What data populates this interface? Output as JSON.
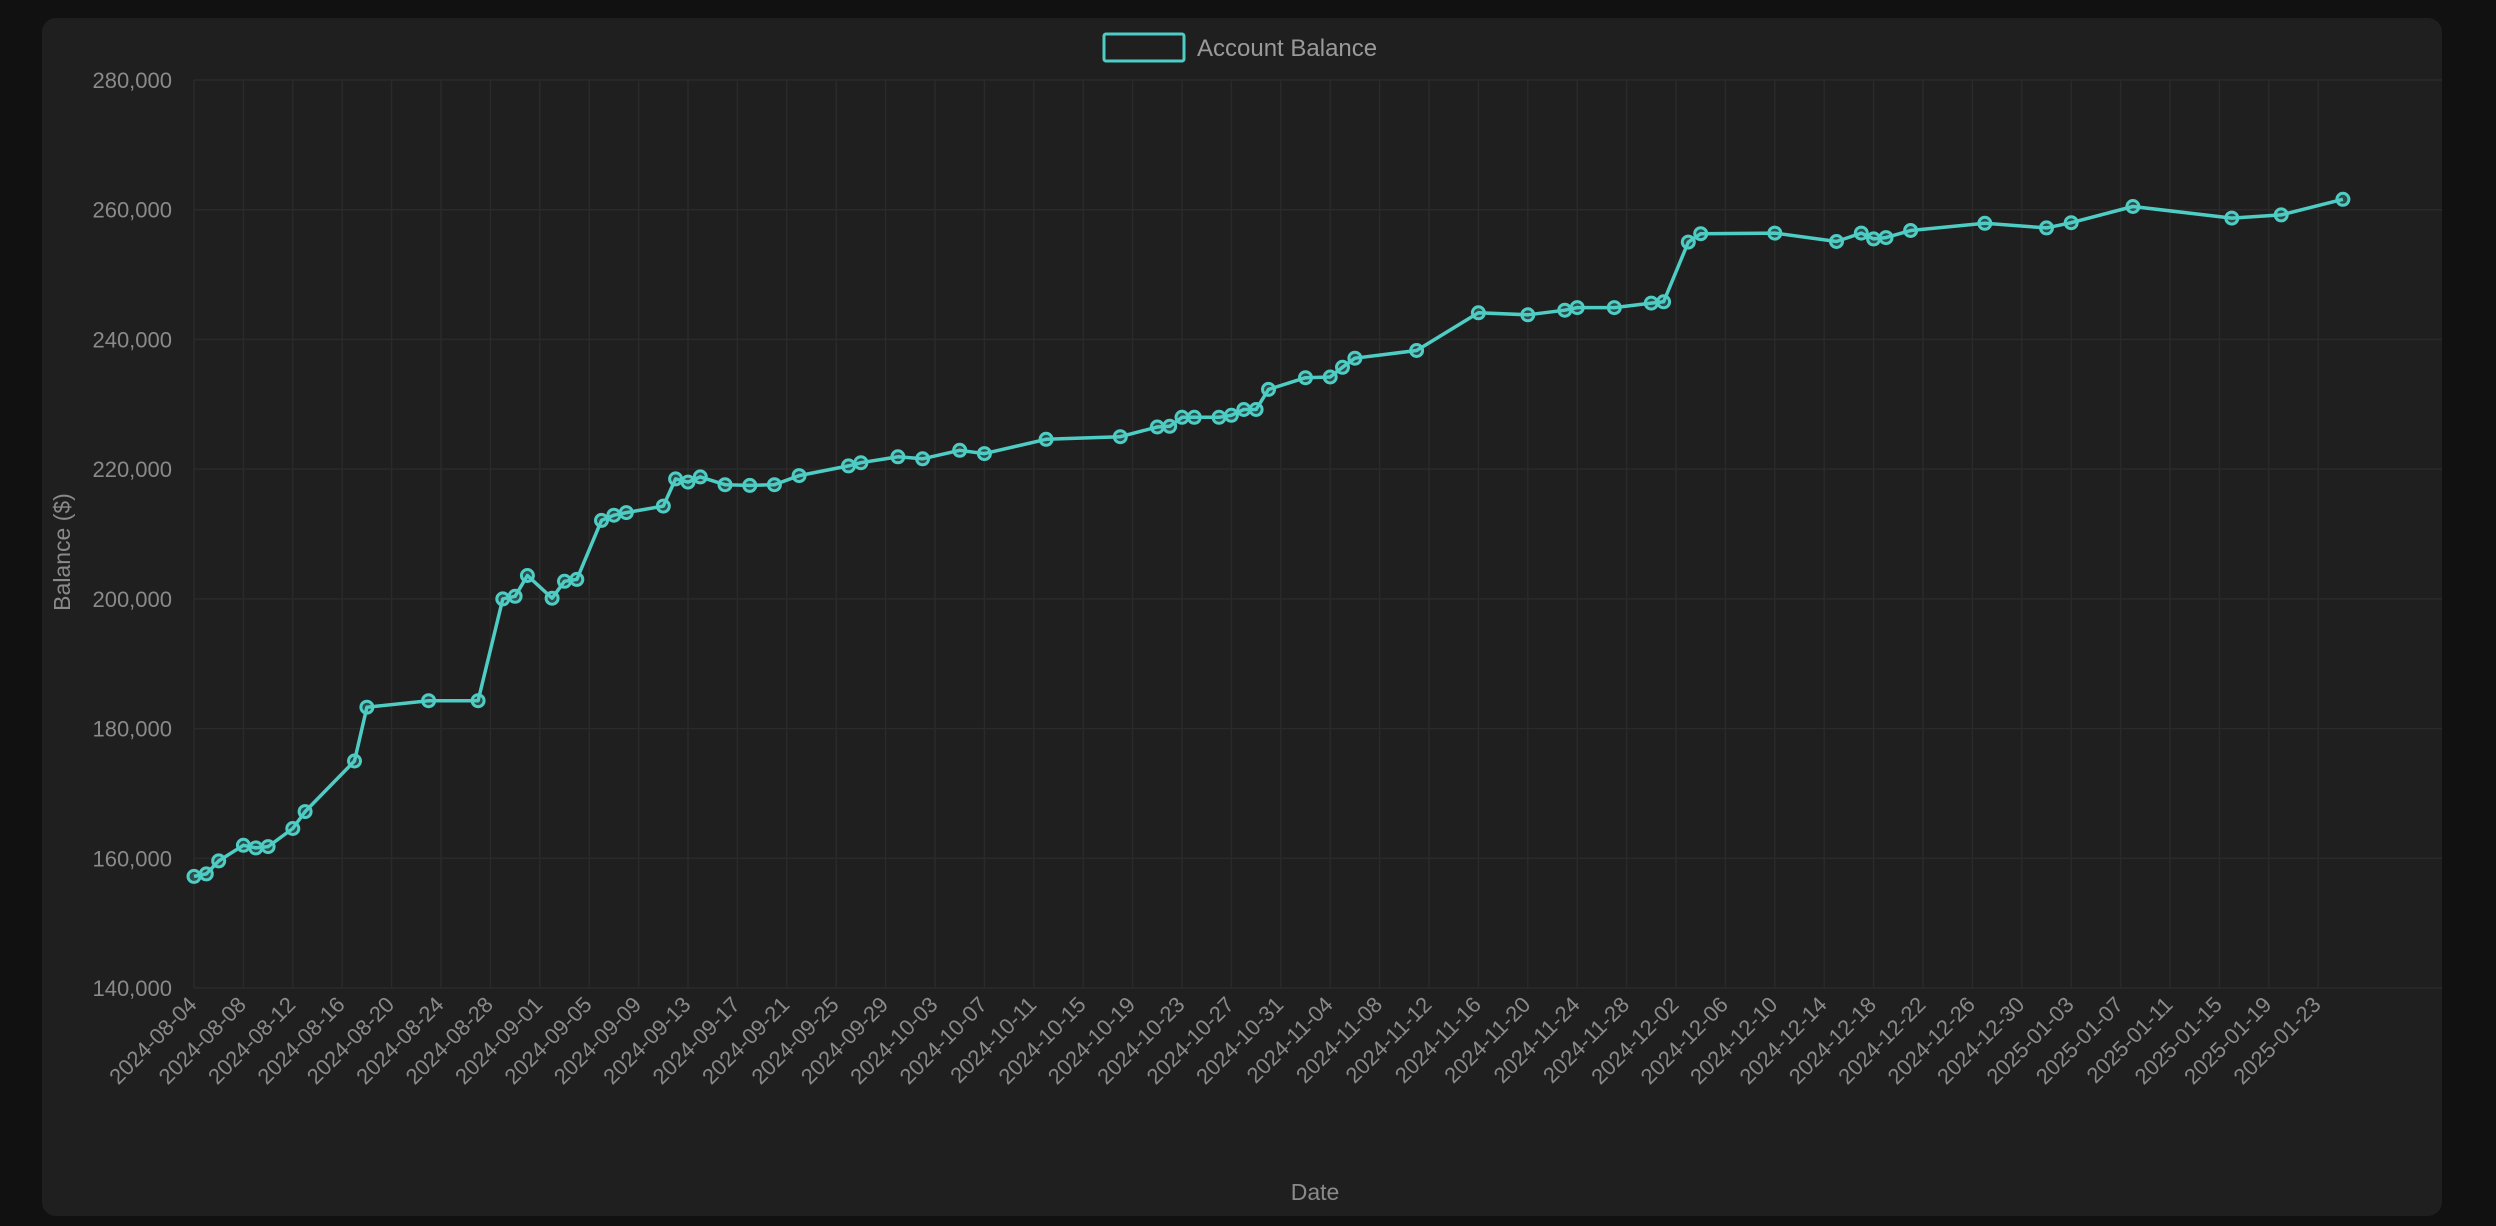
{
  "chart_data": {
    "type": "line",
    "xlabel": "Date",
    "ylabel": "Balance ($)",
    "ylim": [
      140000,
      280000
    ],
    "yticks": [
      140000,
      160000,
      180000,
      200000,
      220000,
      240000,
      260000,
      280000
    ],
    "ytick_labels": [
      "140,000",
      "160,000",
      "180,000",
      "200,000",
      "220,000",
      "240,000",
      "260,000",
      "280,000"
    ],
    "x_tick_labels": [
      "2024-08-04",
      "2024-08-08",
      "2024-08-12",
      "2024-08-16",
      "2024-08-20",
      "2024-08-24",
      "2024-08-28",
      "2024-09-01",
      "2024-09-05",
      "2024-09-09",
      "2024-09-13",
      "2024-09-17",
      "2024-09-21",
      "2024-09-25",
      "2024-09-29",
      "2024-10-03",
      "2024-10-07",
      "2024-10-11",
      "2024-10-15",
      "2024-10-19",
      "2024-10-23",
      "2024-10-27",
      "2024-10-31",
      "2024-11-04",
      "2024-11-08",
      "2024-11-12",
      "2024-11-16",
      "2024-11-20",
      "2024-11-24",
      "2024-11-28",
      "2024-12-02",
      "2024-12-06",
      "2024-12-10",
      "2024-12-14",
      "2024-12-18",
      "2024-12-22",
      "2024-12-26",
      "2024-12-30",
      "2025-01-03",
      "2025-01-07",
      "2025-01-11",
      "2025-01-15",
      "2025-01-19",
      "2025-01-23"
    ],
    "grid": true,
    "legend_position": "top-center",
    "colors": {
      "line": "#4ecdc4",
      "background": "#1f1f1f",
      "grid": "#2a2a2a",
      "text": "#8a8a8a"
    },
    "series": [
      {
        "name": "Account Balance",
        "points": [
          [
            "2024-08-04",
            157200
          ],
          [
            "2024-08-05",
            157600
          ],
          [
            "2024-08-06",
            159600
          ],
          [
            "2024-08-08",
            162000
          ],
          [
            "2024-08-09",
            161600
          ],
          [
            "2024-08-10",
            161800
          ],
          [
            "2024-08-12",
            164600
          ],
          [
            "2024-08-13",
            167200
          ],
          [
            "2024-08-17",
            175000
          ],
          [
            "2024-08-18",
            183300
          ],
          [
            "2024-08-23",
            184300
          ],
          [
            "2024-08-27",
            184300
          ],
          [
            "2024-08-29",
            200000
          ],
          [
            "2024-08-30",
            200400
          ],
          [
            "2024-08-31",
            203600
          ],
          [
            "2024-09-02",
            200100
          ],
          [
            "2024-09-03",
            202700
          ],
          [
            "2024-09-04",
            203000
          ],
          [
            "2024-09-06",
            212100
          ],
          [
            "2024-09-07",
            212900
          ],
          [
            "2024-09-08",
            213300
          ],
          [
            "2024-09-11",
            214300
          ],
          [
            "2024-09-12",
            218500
          ],
          [
            "2024-09-13",
            218000
          ],
          [
            "2024-09-14",
            218800
          ],
          [
            "2024-09-16",
            217600
          ],
          [
            "2024-09-18",
            217500
          ],
          [
            "2024-09-20",
            217600
          ],
          [
            "2024-09-22",
            219000
          ],
          [
            "2024-09-26",
            220500
          ],
          [
            "2024-09-27",
            221000
          ],
          [
            "2024-09-30",
            221900
          ],
          [
            "2024-10-02",
            221600
          ],
          [
            "2024-10-05",
            222900
          ],
          [
            "2024-10-07",
            222400
          ],
          [
            "2024-10-12",
            224600
          ],
          [
            "2024-10-18",
            225000
          ],
          [
            "2024-10-21",
            226500
          ],
          [
            "2024-10-22",
            226600
          ],
          [
            "2024-10-23",
            228000
          ],
          [
            "2024-10-24",
            228000
          ],
          [
            "2024-10-26",
            228000
          ],
          [
            "2024-10-27",
            228300
          ],
          [
            "2024-10-28",
            229200
          ],
          [
            "2024-10-29",
            229200
          ],
          [
            "2024-10-30",
            232300
          ],
          [
            "2024-11-02",
            234100
          ],
          [
            "2024-11-04",
            234200
          ],
          [
            "2024-11-05",
            235700
          ],
          [
            "2024-11-06",
            237100
          ],
          [
            "2024-11-11",
            238300
          ],
          [
            "2024-11-16",
            244100
          ],
          [
            "2024-11-20",
            243800
          ],
          [
            "2024-11-23",
            244500
          ],
          [
            "2024-11-24",
            244900
          ],
          [
            "2024-11-27",
            244900
          ],
          [
            "2024-11-30",
            245600
          ],
          [
            "2024-12-01",
            245800
          ],
          [
            "2024-12-03",
            255000
          ],
          [
            "2024-12-04",
            256300
          ],
          [
            "2024-12-10",
            256400
          ],
          [
            "2024-12-15",
            255100
          ],
          [
            "2024-12-17",
            256400
          ],
          [
            "2024-12-18",
            255500
          ],
          [
            "2024-12-19",
            255700
          ],
          [
            "2024-12-21",
            256800
          ],
          [
            "2024-12-27",
            257900
          ],
          [
            "2025-01-01",
            257200
          ],
          [
            "2025-01-03",
            258000
          ],
          [
            "2025-01-08",
            260500
          ],
          [
            "2025-01-16",
            258700
          ],
          [
            "2025-01-20",
            259200
          ],
          [
            "2025-01-25",
            261600
          ]
        ]
      }
    ]
  }
}
